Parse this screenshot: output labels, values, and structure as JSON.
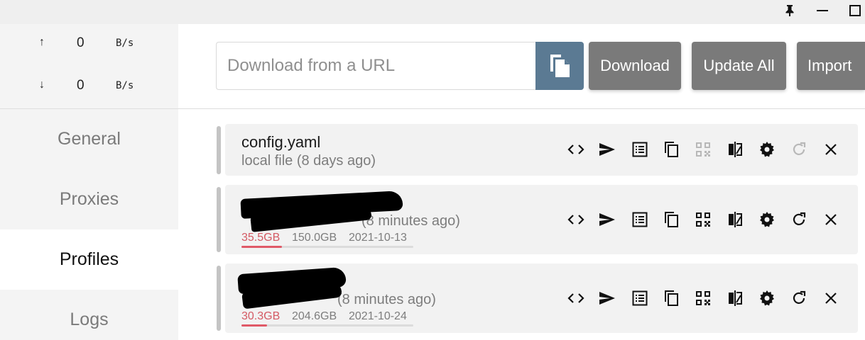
{
  "traffic": {
    "up": {
      "arrow": "↑",
      "value": "0",
      "unit": "B/s"
    },
    "down": {
      "arrow": "↓",
      "value": "0",
      "unit": "B/s"
    }
  },
  "nav": {
    "items": [
      {
        "label": "General"
      },
      {
        "label": "Proxies"
      },
      {
        "label": "Profiles",
        "active": true
      },
      {
        "label": "Logs"
      }
    ]
  },
  "toolbar": {
    "url_placeholder": "Download from a URL",
    "download_label": "Download",
    "update_all_label": "Update All",
    "import_label": "Import"
  },
  "profiles": [
    {
      "name": "config.yaml",
      "subtitle": "local file (8 days ago)"
    },
    {
      "name": "",
      "subtitle": "(8 minutes ago)",
      "used": "35.5GB",
      "total": "150.0GB",
      "expire": "2021-10-13",
      "usage_fraction": 0.237
    },
    {
      "name": "",
      "subtitle": "(8 minutes ago)",
      "used": "30.3GB",
      "total": "204.6GB",
      "expire": "2021-10-24",
      "usage_fraction": 0.148
    }
  ],
  "colors": {
    "paste_button": "#5b7a93",
    "action_button": "#7a7a7a",
    "usage_fill": "#e05a68",
    "used_text": "#d45a64"
  },
  "icons": [
    "pin-icon",
    "minimize-icon",
    "maximize-icon",
    "paste-icon",
    "code-icon",
    "send-icon",
    "list-icon",
    "copy-icon",
    "qr-code-icon",
    "compare-icon",
    "settings-icon",
    "refresh-icon",
    "close-icon"
  ]
}
